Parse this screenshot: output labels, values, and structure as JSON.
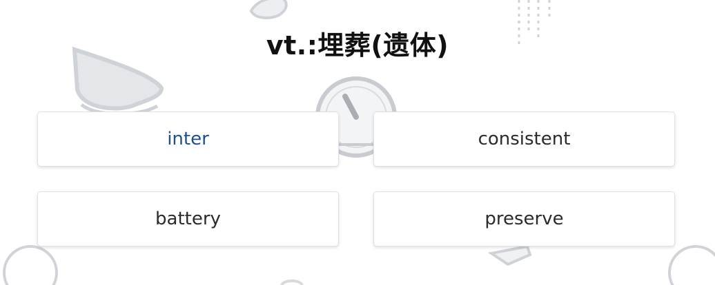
{
  "question": {
    "text": "vt.:埋葬(遗体)"
  },
  "options": [
    {
      "label": "inter"
    },
    {
      "label": "consistent"
    },
    {
      "label": "battery"
    },
    {
      "label": "preserve"
    }
  ],
  "colors": {
    "active_option": "#1f4f8e",
    "option_text": "#2b2b2b",
    "background_art": "#d9dadd"
  }
}
